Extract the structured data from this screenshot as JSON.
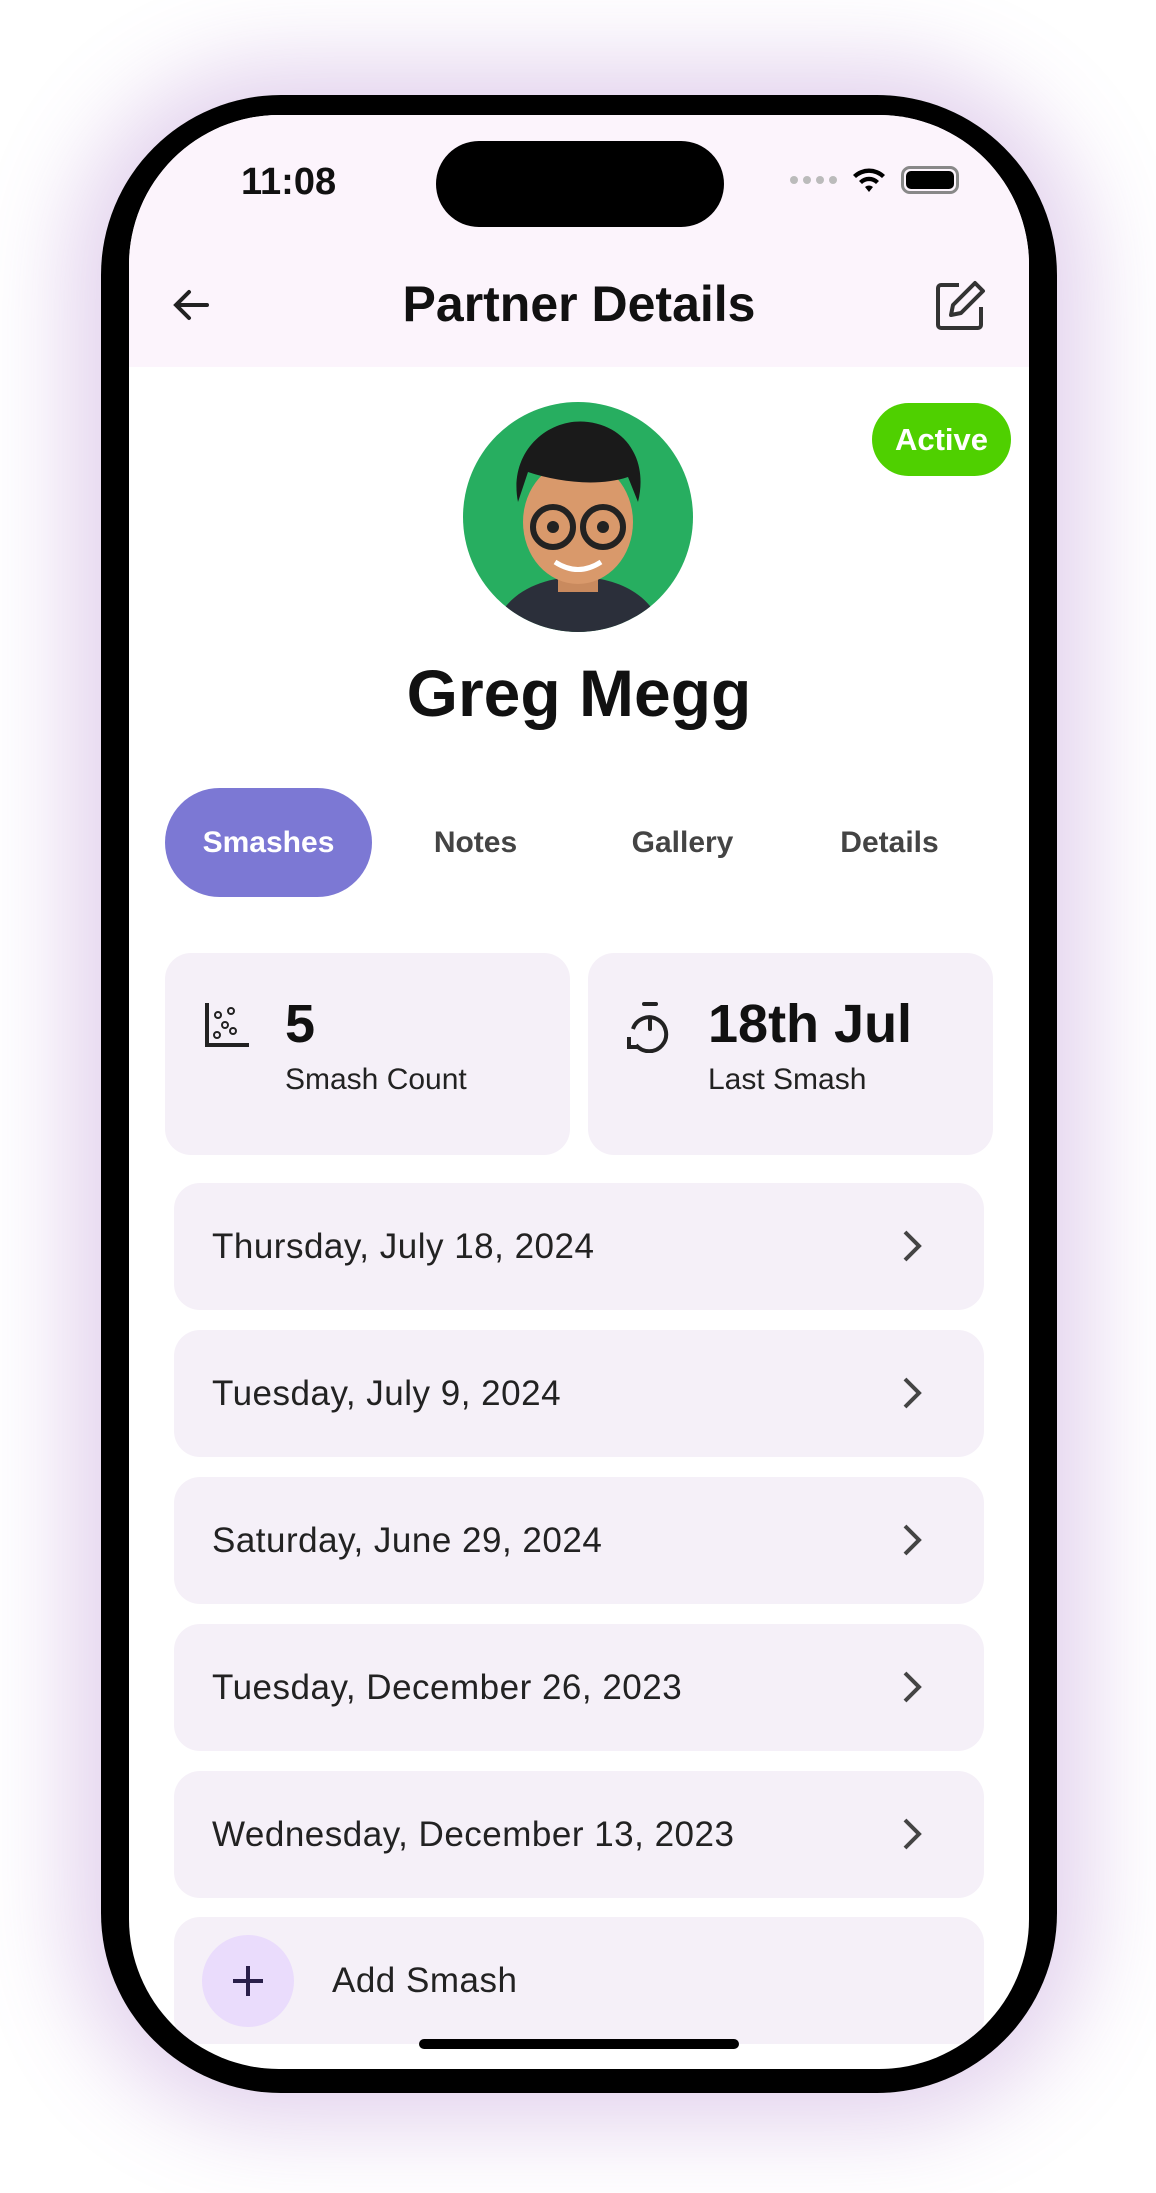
{
  "status_bar": {
    "time": "11:08"
  },
  "header": {
    "title": "Partner Details",
    "back_icon": "arrow-left-icon",
    "edit_icon": "edit-icon"
  },
  "profile": {
    "name": "Greg Megg",
    "status": "Active",
    "status_color": "#4fd000",
    "avatar_bg": "#27ae60"
  },
  "tabs": [
    {
      "label": "Smashes",
      "active": true
    },
    {
      "label": "Notes"
    },
    {
      "label": "Gallery"
    },
    {
      "label": "Details"
    }
  ],
  "accent": "#7c78d4",
  "stats": [
    {
      "value": "5",
      "label": "Smash Count",
      "icon": "scatter-chart-icon"
    },
    {
      "value": "18th Jul",
      "label": "Last Smash",
      "icon": "timer-history-icon"
    }
  ],
  "smashes": [
    "Thursday, July 18, 2024",
    "Tuesday, July 9, 2024",
    "Saturday, June 29, 2024",
    "Tuesday, December 26, 2023",
    "Wednesday, December 13, 2023"
  ],
  "add_label": "Add Smash"
}
